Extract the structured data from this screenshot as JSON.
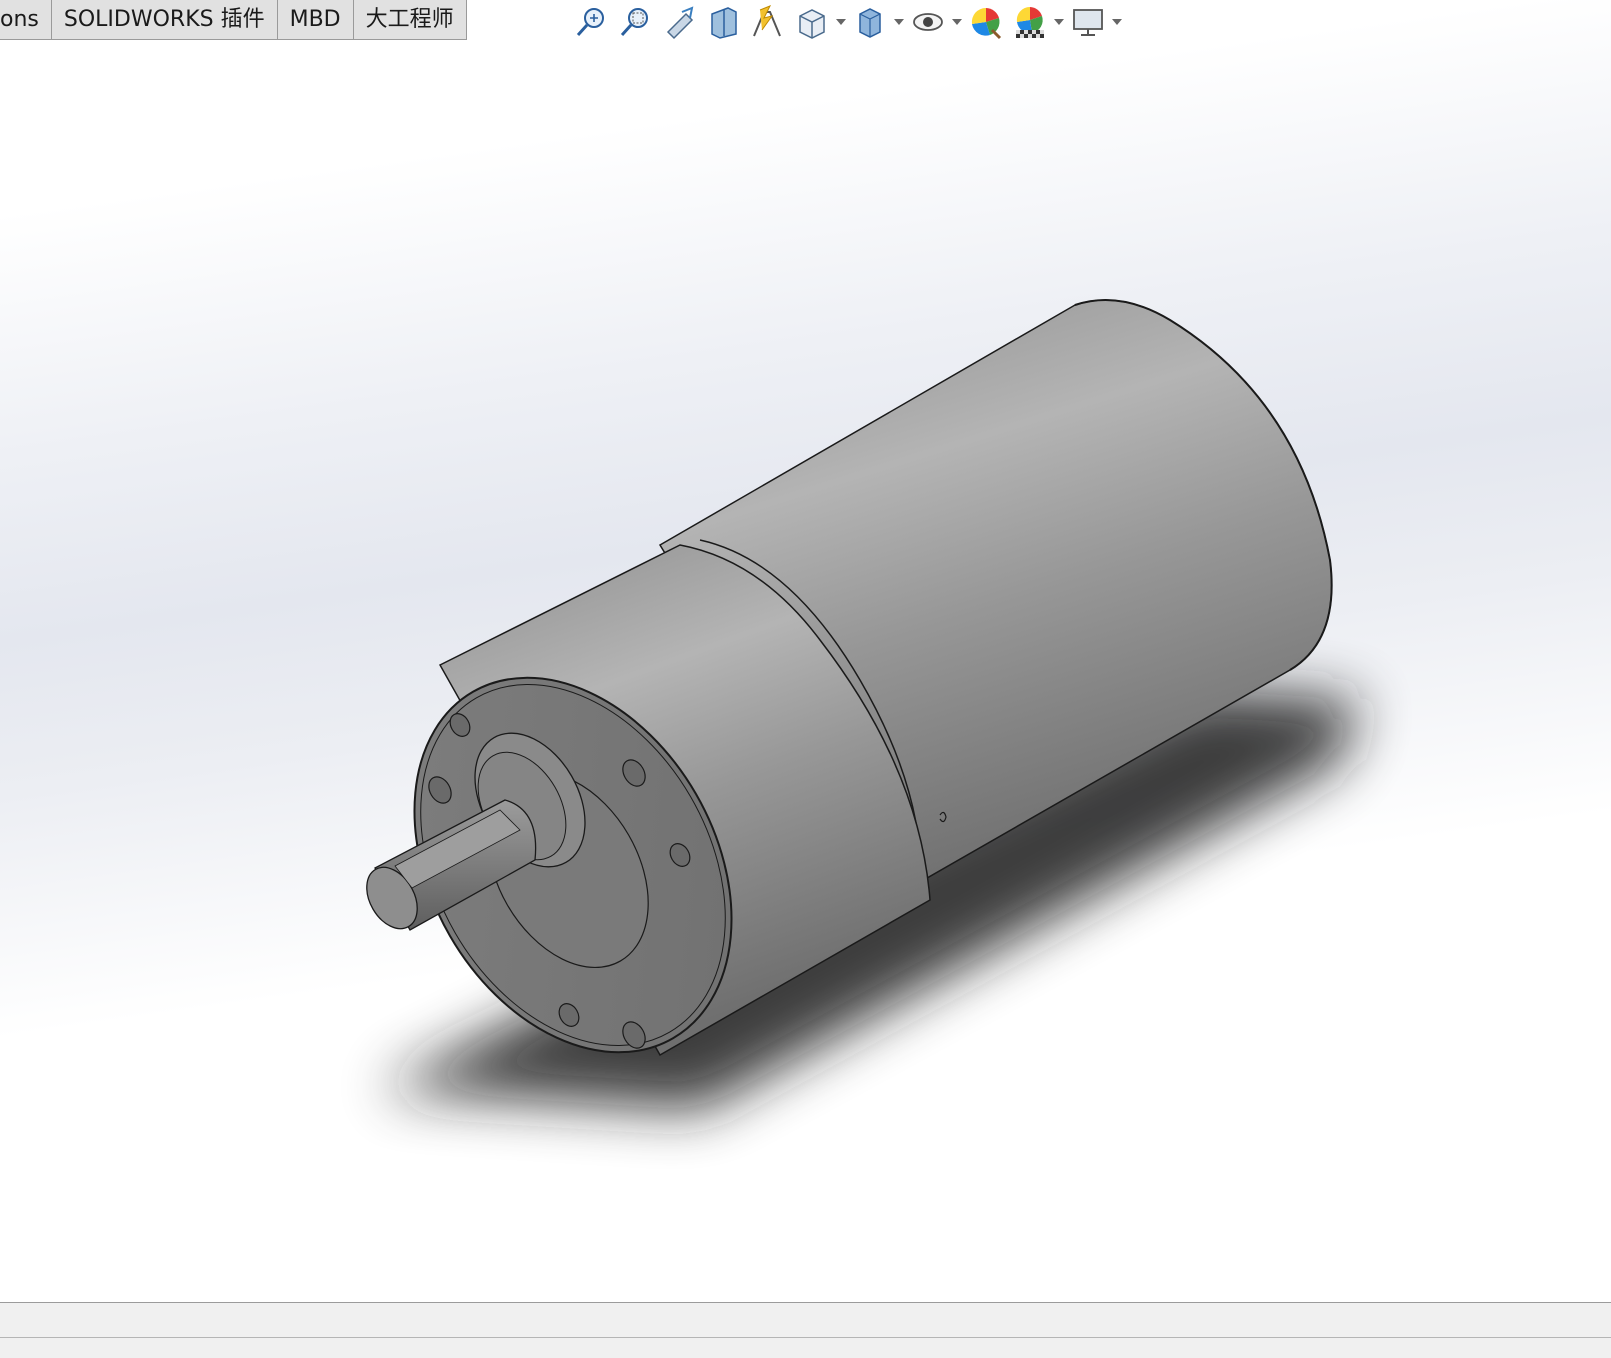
{
  "tabs": [
    {
      "label": "ons"
    },
    {
      "label": "SOLIDWORKS 插件"
    },
    {
      "label": "MBD"
    },
    {
      "label": "大工程师"
    }
  ],
  "toolbar": {
    "icons": [
      "zoom-to-fit-icon",
      "zoom-to-area-icon",
      "previous-view-icon",
      "section-view-icon",
      "dynamic-annotation-view-icon",
      "view-orientation-icon",
      "display-style-icon",
      "hide-show-items-icon",
      "edit-appearance-icon",
      "apply-scene-icon",
      "view-settings-icon"
    ]
  },
  "colors": {
    "accent": "#5b9bd5",
    "model_body": "#9a9a9a",
    "tab_bg": "#e1e1e1"
  }
}
